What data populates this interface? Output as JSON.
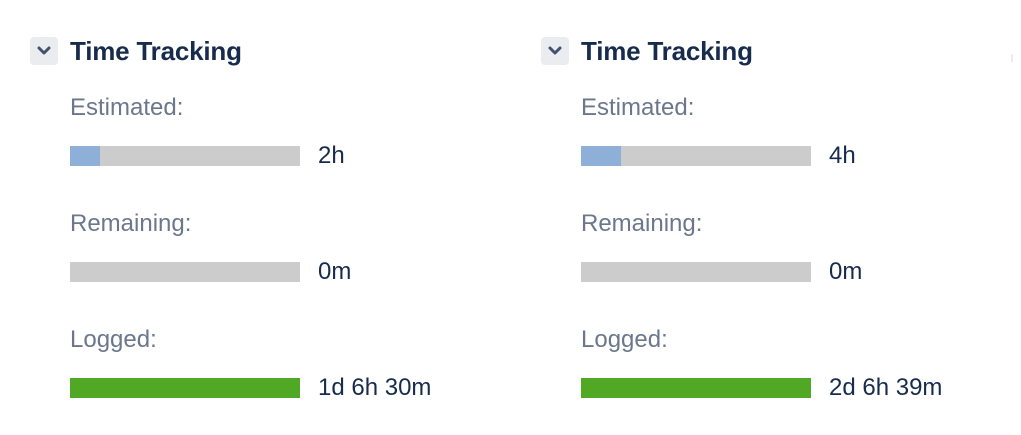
{
  "colors": {
    "estimated_fill": "#8eb0d8",
    "logged_fill": "#51a825",
    "track": "#cccccc",
    "label": "#6b778c",
    "text": "#172b4d"
  },
  "panels": [
    {
      "title": "Time Tracking",
      "toggle_icon": "chevron-down-icon",
      "estimated": {
        "label": "Estimated:",
        "value": "2h",
        "fill_fraction": 0.13
      },
      "remaining": {
        "label": "Remaining:",
        "value": "0m",
        "fill_fraction": 0
      },
      "logged": {
        "label": "Logged:",
        "value": "1d 6h 30m",
        "fill_fraction": 1.0
      }
    },
    {
      "title": "Time Tracking",
      "toggle_icon": "chevron-down-icon",
      "estimated": {
        "label": "Estimated:",
        "value": "4h",
        "fill_fraction": 0.174
      },
      "remaining": {
        "label": "Remaining:",
        "value": "0m",
        "fill_fraction": 0
      },
      "logged": {
        "label": "Logged:",
        "value": "2d 6h 39m",
        "fill_fraction": 1.0
      }
    }
  ]
}
